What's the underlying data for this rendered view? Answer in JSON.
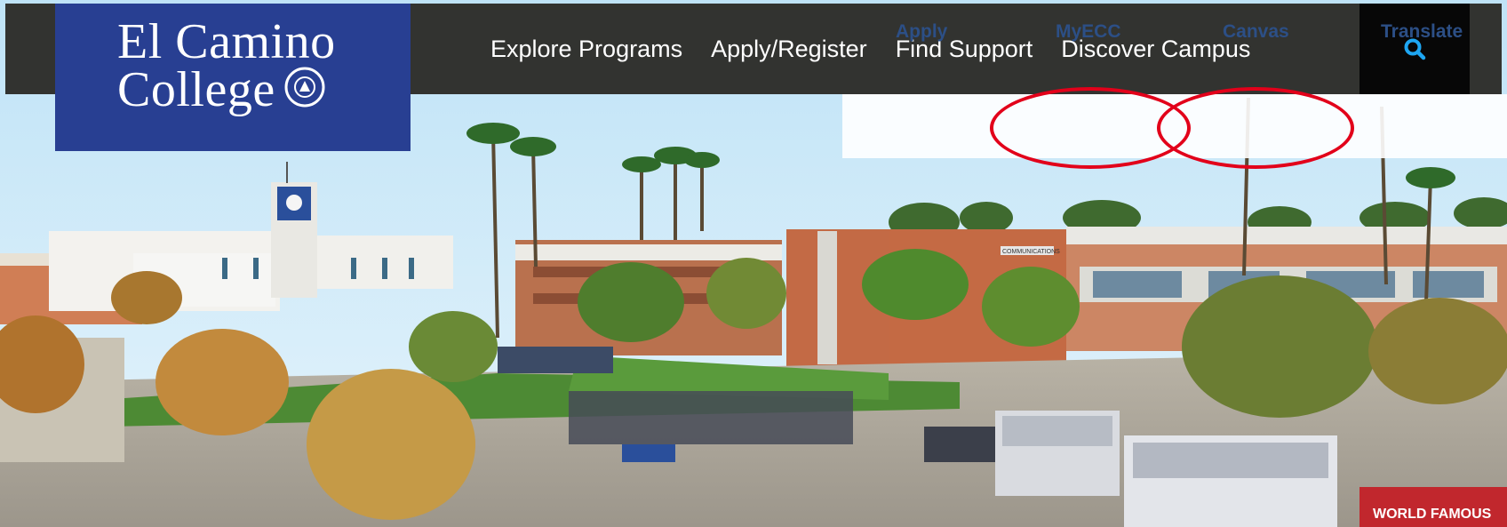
{
  "logo": {
    "line1": "El Camino",
    "line2": "College",
    "seal_text": "EL CAMINO COLLEGE"
  },
  "nav": {
    "items": [
      "Explore Programs",
      "Apply/Register",
      "Find Support",
      "Discover Campus"
    ],
    "search_icon": "search-icon"
  },
  "utility": {
    "apply": "Apply",
    "myecc": "MyECC",
    "canvas": "Canvas",
    "translate": "Translate"
  },
  "annotations": {
    "highlight_color": "#e2001a",
    "highlighted": [
      "MyECC",
      "Canvas"
    ]
  },
  "hero": {
    "description_icons": [
      "palm-tree-icon",
      "clock-tower-icon",
      "food-truck-icon"
    ],
    "building_sign": "COMMUNICATIONS",
    "truck_text": "WORLD FAMOUS"
  },
  "colors": {
    "topbar": "#323330",
    "logo_bg": "#283f92",
    "search_bg": "#070707",
    "link": "#2c4f86"
  }
}
